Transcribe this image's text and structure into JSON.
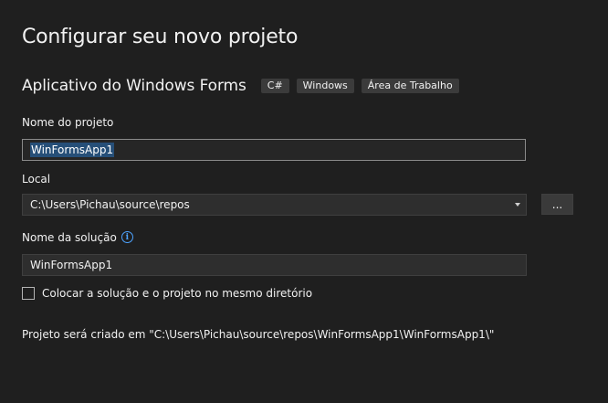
{
  "page": {
    "title": "Configurar seu novo projeto"
  },
  "template": {
    "name": "Aplicativo do Windows Forms",
    "tags": [
      "C#",
      "Windows",
      "Área de Trabalho"
    ]
  },
  "project_name": {
    "label": "Nome do projeto",
    "value": "WinFormsApp1"
  },
  "location": {
    "label": "Local",
    "value": "C:\\Users\\Pichau\\source\\repos",
    "browse_label": "..."
  },
  "solution_name": {
    "label": "Nome da solução",
    "info_icon": "info-icon",
    "info_glyph": "i",
    "value": "WinFormsApp1"
  },
  "same_directory": {
    "label": "Colocar a solução e o projeto no mesmo diretório",
    "checked": false
  },
  "summary": {
    "text": "Projeto será criado em \"C:\\Users\\Pichau\\source\\repos\\WinFormsApp1\\WinFormsApp1\\\""
  },
  "colors": {
    "background": "#1f1f1f",
    "input_background": "#2e2e2e",
    "selection": "#264f78",
    "tag_background": "#3b3b3b",
    "info_accent": "#4da3ff"
  }
}
